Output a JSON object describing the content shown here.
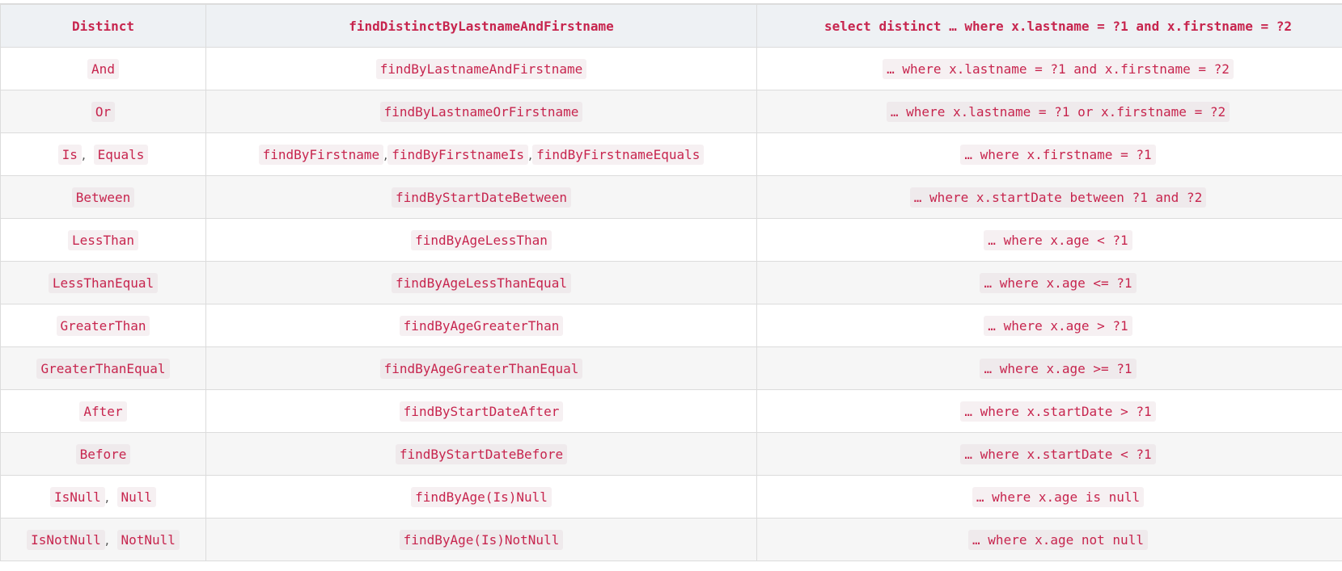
{
  "header": [
    "Distinct",
    "findDistinctByLastnameAndFirstname",
    "select distinct … where x.lastname = ?1 and x.firstname = ?2"
  ],
  "rows": [
    {
      "keywords": [
        "And"
      ],
      "samples": [
        "findByLastnameAndFirstname"
      ],
      "jpql": "… where x.lastname = ?1 and x.firstname = ?2"
    },
    {
      "keywords": [
        "Or"
      ],
      "samples": [
        "findByLastnameOrFirstname"
      ],
      "jpql": "… where x.lastname = ?1 or x.firstname = ?2"
    },
    {
      "keywords": [
        "Is",
        "Equals"
      ],
      "samples": [
        "findByFirstname",
        "findByFirstnameIs",
        "findByFirstnameEquals"
      ],
      "jpql": "… where x.firstname = ?1"
    },
    {
      "keywords": [
        "Between"
      ],
      "samples": [
        "findByStartDateBetween"
      ],
      "jpql": "… where x.startDate between ?1 and ?2"
    },
    {
      "keywords": [
        "LessThan"
      ],
      "samples": [
        "findByAgeLessThan"
      ],
      "jpql": "… where x.age < ?1"
    },
    {
      "keywords": [
        "LessThanEqual"
      ],
      "samples": [
        "findByAgeLessThanEqual"
      ],
      "jpql": "… where x.age <= ?1"
    },
    {
      "keywords": [
        "GreaterThan"
      ],
      "samples": [
        "findByAgeGreaterThan"
      ],
      "jpql": "… where x.age > ?1"
    },
    {
      "keywords": [
        "GreaterThanEqual"
      ],
      "samples": [
        "findByAgeGreaterThanEqual"
      ],
      "jpql": "… where x.age >= ?1"
    },
    {
      "keywords": [
        "After"
      ],
      "samples": [
        "findByStartDateAfter"
      ],
      "jpql": "… where x.startDate > ?1"
    },
    {
      "keywords": [
        "Before"
      ],
      "samples": [
        "findByStartDateBefore"
      ],
      "jpql": "… where x.startDate < ?1"
    },
    {
      "keywords": [
        "IsNull",
        "Null"
      ],
      "samples": [
        "findByAge(Is)Null"
      ],
      "jpql": "… where x.age is null"
    },
    {
      "keywords": [
        "IsNotNull",
        "NotNull"
      ],
      "samples": [
        "findByAge(Is)NotNull"
      ],
      "jpql": "… where x.age not null"
    }
  ],
  "separator": ","
}
